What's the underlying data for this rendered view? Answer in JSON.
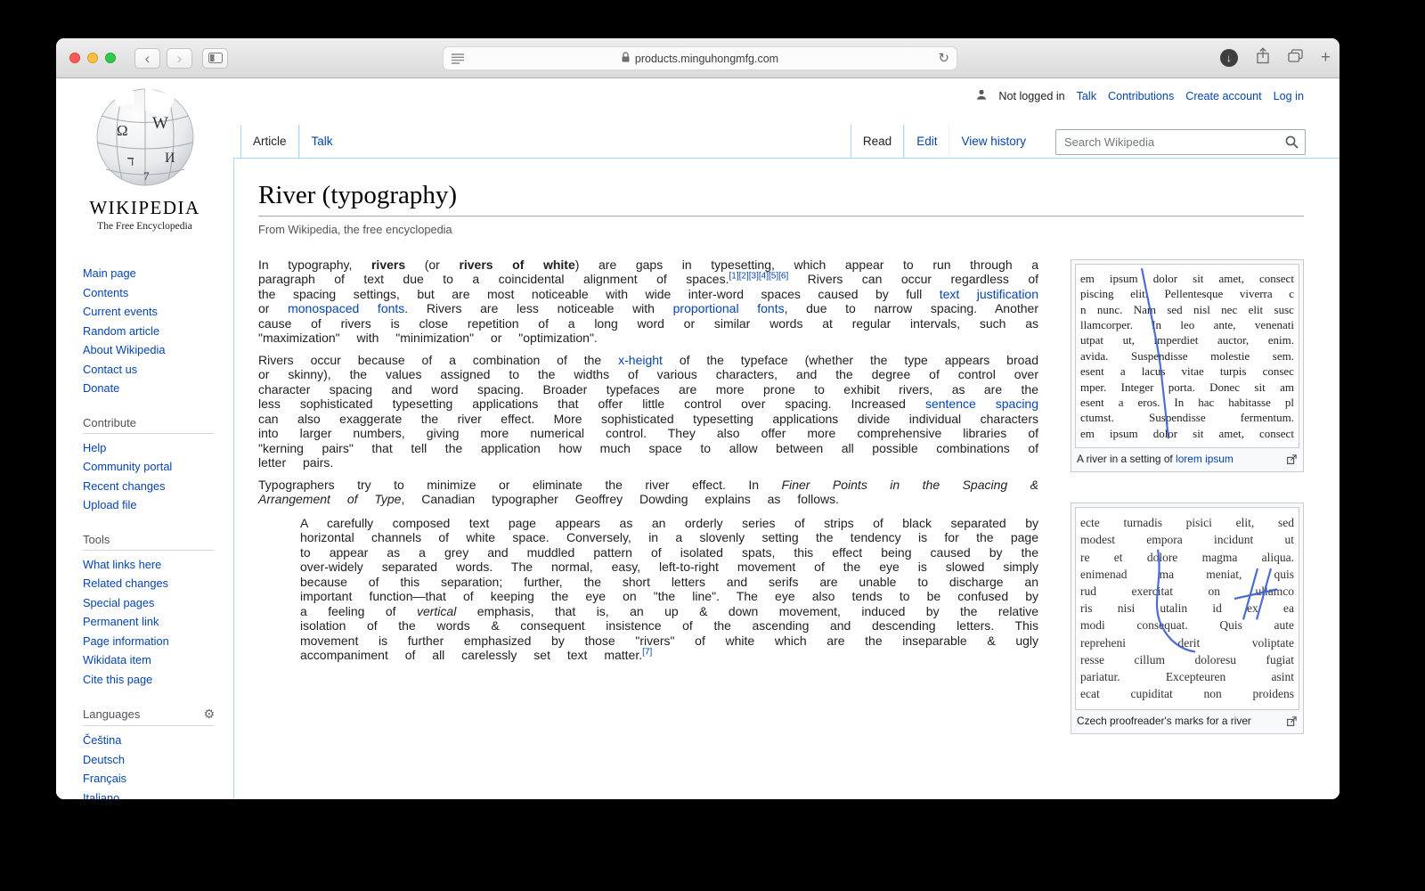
{
  "browser": {
    "url": "products.minguhongmfg.com",
    "new_tab_label": "+"
  },
  "personal": {
    "status": "Not logged in",
    "links": [
      "Talk",
      "Contributions",
      "Create account",
      "Log in"
    ]
  },
  "logo": {
    "wordmark": "WIKIPEDIA",
    "tagline": "The Free Encyclopedia"
  },
  "sidebar": {
    "sections": [
      {
        "title": "",
        "items": [
          "Main page",
          "Contents",
          "Current events",
          "Random article",
          "About Wikipedia",
          "Contact us",
          "Donate"
        ]
      },
      {
        "title": "Contribute",
        "items": [
          "Help",
          "Community portal",
          "Recent changes",
          "Upload file"
        ]
      },
      {
        "title": "Tools",
        "items": [
          "What links here",
          "Related changes",
          "Special pages",
          "Permanent link",
          "Page information",
          "Wikidata item",
          "Cite this page"
        ]
      },
      {
        "title": "Languages",
        "has_gear": true,
        "items": [
          "Čeština",
          "Deutsch",
          "Français",
          "Italiano"
        ]
      }
    ]
  },
  "header": {
    "tabs_left": [
      {
        "label": "Article",
        "active": true
      },
      {
        "label": "Talk",
        "active": false
      }
    ],
    "tabs_right": [
      {
        "label": "Read",
        "active": true
      },
      {
        "label": "Edit",
        "active": false
      },
      {
        "label": "View history",
        "active": false
      }
    ],
    "search_placeholder": "Search Wikipedia"
  },
  "article": {
    "title": "River (typography)",
    "tagline": "From Wikipedia, the free encyclopedia",
    "blocks": [
      {
        "kind": "p",
        "segments": [
          {
            "s": "plain",
            "t": "In typography, "
          },
          {
            "s": "b",
            "t": "rivers"
          },
          {
            "s": "plain",
            "t": " (or "
          },
          {
            "s": "b",
            "t": "rivers of white"
          },
          {
            "s": "plain",
            "t": ") are gaps in typesetting, which appear to run through a paragraph of text due to a coincidental alignment of spaces."
          },
          {
            "s": "ref",
            "t": "[1]"
          },
          {
            "s": "ref",
            "t": "[2]"
          },
          {
            "s": "ref",
            "t": "[3]"
          },
          {
            "s": "ref",
            "t": "[4]"
          },
          {
            "s": "ref",
            "t": "[5]"
          },
          {
            "s": "ref",
            "t": "[6]"
          },
          {
            "s": "plain",
            "t": " Rivers can occur regardless of the spacing settings, but are most noticeable with wide inter-word spaces caused by full "
          },
          {
            "s": "link",
            "t": "text justification"
          },
          {
            "s": "plain",
            "t": " or "
          },
          {
            "s": "link",
            "t": "monospaced fonts"
          },
          {
            "s": "plain",
            "t": ". Rivers are less noticeable with "
          },
          {
            "s": "link",
            "t": "proportional fonts"
          },
          {
            "s": "plain",
            "t": ", due to narrow spacing. Another cause of rivers is close repetition of a long word or similar words at regular intervals, such as \"maximization\" with \"minimization\" or \"optimization\"."
          }
        ]
      },
      {
        "kind": "p",
        "segments": [
          {
            "s": "plain",
            "t": "Rivers occur because of a combination of the "
          },
          {
            "s": "link",
            "t": "x-height"
          },
          {
            "s": "plain",
            "t": " of the typeface (whether the type appears broad or skinny), the values assigned to the widths of various characters, and the degree of control over character spacing and word spacing. Broader typefaces are more prone to exhibit rivers, as are the less sophisticated typesetting applications that offer little control over spacing. Increased "
          },
          {
            "s": "link",
            "t": "sentence spacing"
          },
          {
            "s": "plain",
            "t": " can also exaggerate the river effect. More sophisticated typesetting applications divide individual characters into larger numbers, giving more numerical control. They also offer more comprehensive libraries of \"kerning pairs\" that tell the application how much space to allow between all possible combinations of letter pairs."
          }
        ]
      },
      {
        "kind": "p",
        "segments": [
          {
            "s": "plain",
            "t": "Typographers try to minimize or eliminate the river effect. In "
          },
          {
            "s": "i",
            "t": "Finer Points in the Spacing & Arrangement of Type"
          },
          {
            "s": "plain",
            "t": ", Canadian typographer Geoffrey Dowding explains as follows."
          }
        ]
      },
      {
        "kind": "quote",
        "segments": [
          {
            "s": "plain",
            "t": "A carefully composed text page appears as an orderly series of strips of black separated by horizontal channels of white space. Conversely, in a slovenly setting the tendency is for the page to appear as a grey and muddled pattern of isolated spats, this effect being caused by the over-widely separated words. The normal, easy, left-to-right movement of the eye is slowed simply because of this separation; further, the short letters and serifs are unable to discharge an important function—that of keeping the eye on \"the line\". The eye also tends to be confused by a feeling of "
          },
          {
            "s": "i",
            "t": "vertical"
          },
          {
            "s": "plain",
            "t": " emphasis, that is, an up & down movement, induced by the relative isolation of the words & consequent insistence of the ascending and descending letters. This movement is further emphasized by those \"rivers\" of white which are the inseparable & ugly accompaniment of all carelessly set text matter."
          },
          {
            "s": "ref",
            "t": "[7]"
          }
        ]
      }
    ],
    "figures": [
      {
        "lines": [
          "em ipsum dolor sit amet, consect",
          "piscing elit. Pellentesque viverra c",
          "n nunc. Nam sed nisl nec elit susc",
          "llamcorper. In leo ante, venenati",
          "utpat ut, imperdiet auctor, enim.",
          "avida. Suspendisse molestie sem.",
          "esent a lacus vitae turpis consec",
          "mper. Integer porta. Donec sit am",
          "esent a eros. In hac habitasse pl",
          "ctumst. Suspendisse fermentum.",
          "em ipsum dolor sit amet, consect"
        ],
        "caption": [
          {
            "s": "plain",
            "t": "A river in a setting of "
          },
          {
            "s": "link",
            "t": "lorem ipsum"
          }
        ]
      },
      {
        "lines": [
          "ecte turnadis pisici elit, sed",
          "modest empora incidunt ut",
          "re et dolore magma aliqua.",
          "enimenad ma meniat, quis",
          "rud exercitat on ullamco",
          "ris nisi utalin id ex ea",
          "modi consequat. Quis aute",
          "repreheni derit voliptate",
          "resse cillum doloresu fugiat",
          "pariatur. Excepteuren asint",
          "ecat cupiditat non proidens"
        ],
        "caption": [
          {
            "s": "plain",
            "t": "Czech proofreader's marks for a river"
          }
        ]
      }
    ]
  },
  "colors": {
    "link_blue": "#0645ad",
    "header_border_blue": "#a7d7f9",
    "proof_mark_blue": "#3a5fcd",
    "traffic_red": "#fc5b57",
    "traffic_yellow": "#fdbe41",
    "traffic_green": "#34c84a"
  }
}
